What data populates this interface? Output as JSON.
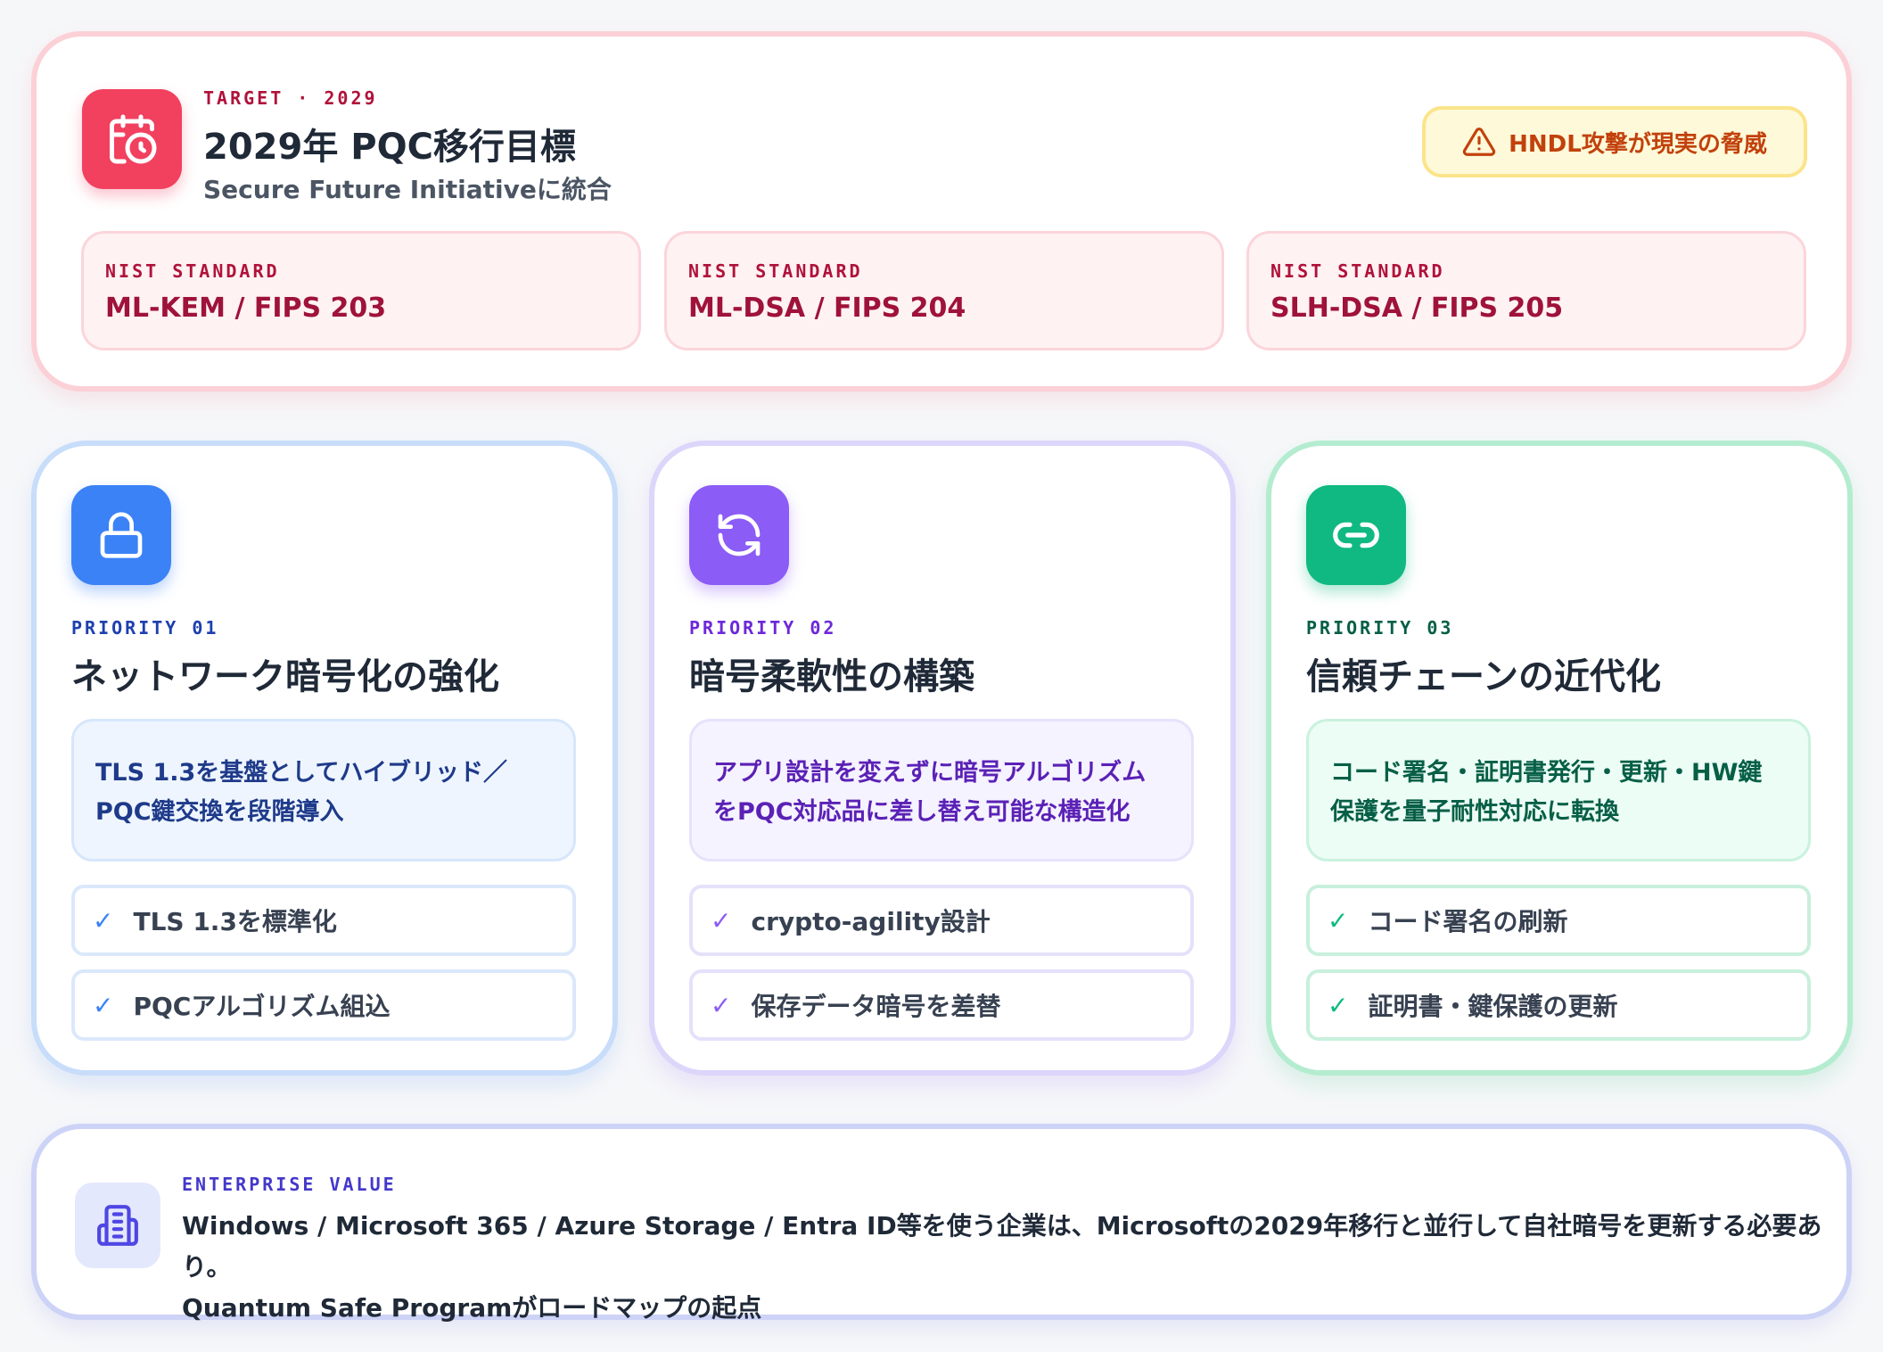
{
  "target": {
    "kicker": "TARGET · 2029",
    "title": "2029年 PQC移行目標",
    "subtitle": "Secure Future Initiativeに統合",
    "icon": "calendar-clock-icon",
    "alert": "HNDL攻撃が現実の脅威",
    "standards": [
      {
        "kicker": "NIST STANDARD",
        "value": "ML-KEM / FIPS 203"
      },
      {
        "kicker": "NIST STANDARD",
        "value": "ML-DSA / FIPS 204"
      },
      {
        "kicker": "NIST STANDARD",
        "value": "SLH-DSA / FIPS 205"
      }
    ]
  },
  "priorities": [
    {
      "kicker": "PRIORITY 01",
      "title": "ネットワーク暗号化の強化",
      "icon": "lock-icon",
      "desc_line1": "TLS 1.3を基盤としてハイブリッド／",
      "desc_line2": "PQC鍵交換を段階導入",
      "items": [
        "TLS 1.3を標準化",
        "PQCアルゴリズム組込"
      ],
      "color": "#3b82f6"
    },
    {
      "kicker": "PRIORITY 02",
      "title": "暗号柔軟性の構築",
      "icon": "refresh-icon",
      "desc_line1": "アプリ設計を変えずに暗号アルゴリズム",
      "desc_line2": "をPQC対応品に差し替え可能な構造化",
      "items": [
        "crypto-agility設計",
        "保存データ暗号を差替"
      ],
      "color": "#8b5cf6"
    },
    {
      "kicker": "PRIORITY 03",
      "title": "信頼チェーンの近代化",
      "icon": "link-icon",
      "desc_line1": "コード署名・証明書発行・更新・HW鍵",
      "desc_line2": "保護を量子耐性対応に転換",
      "items": [
        "コード署名の刷新",
        "証明書・鍵保護の更新"
      ],
      "color": "#10b981"
    }
  ],
  "enterprise": {
    "kicker": "ENTERPRISE VALUE",
    "icon": "building-icon",
    "line1": "Windows / Microsoft 365 / Azure Storage / Entra ID等を使う企業は、Microsoftの2029年移行と並行して自社暗号を更新する必要あり。",
    "line2": "Quantum Safe Programがロードマップの起点"
  },
  "check_glyph": "✓"
}
